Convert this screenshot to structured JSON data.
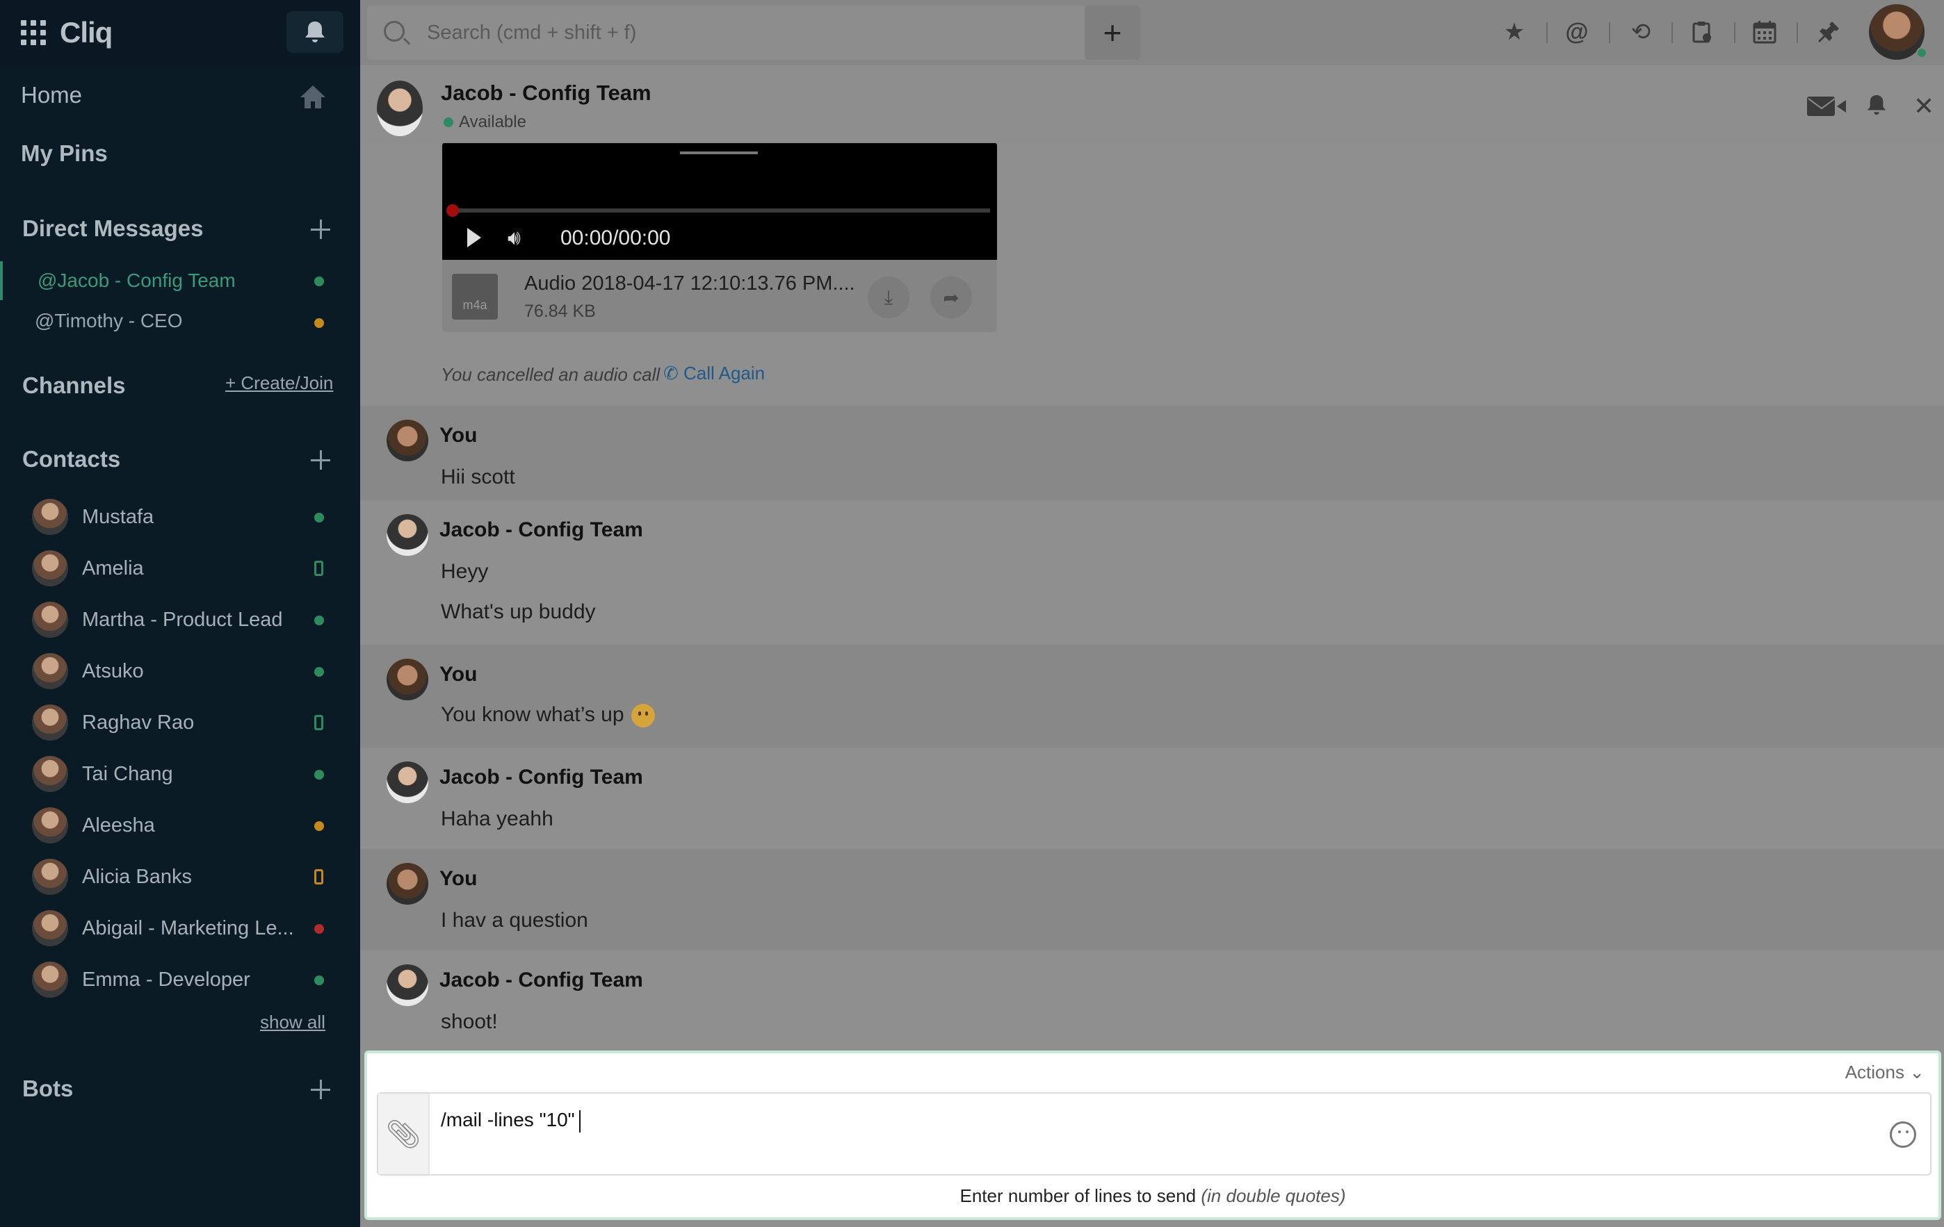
{
  "app": {
    "name": "Cliq"
  },
  "sidebar": {
    "home": "Home",
    "pins": "My Pins",
    "direct_messages": {
      "title": "Direct Messages",
      "items": [
        {
          "label": "@Jacob - Config Team",
          "status": "green",
          "active": true
        },
        {
          "label": "@Timothy - CEO",
          "status": "yellow",
          "active": false
        }
      ]
    },
    "channels": {
      "title": "Channels",
      "create_join": "+ Create/Join"
    },
    "contacts": {
      "title": "Contacts",
      "items": [
        {
          "name": "Mustafa",
          "status": "green-dot"
        },
        {
          "name": "Amelia",
          "status": "green-phone"
        },
        {
          "name": "Martha -  Product Lead",
          "status": "green-dot"
        },
        {
          "name": "Atsuko",
          "status": "green-dot"
        },
        {
          "name": "Raghav Rao",
          "status": "green-phone"
        },
        {
          "name": "Tai Chang",
          "status": "green-dot"
        },
        {
          "name": "Aleesha",
          "status": "yellow-dot"
        },
        {
          "name": "Alicia Banks",
          "status": "yellow-phone"
        },
        {
          "name": "Abigail - Marketing Le...",
          "status": "red-dot"
        },
        {
          "name": "Emma - Developer",
          "status": "green-dot"
        }
      ],
      "show_all": "show all"
    },
    "bots": {
      "title": "Bots"
    }
  },
  "topbar": {
    "search_placeholder": "Search (cmd + shift + f)",
    "icons": [
      "star-icon",
      "mention-icon",
      "history-icon",
      "clipboard-icon",
      "calendar-icon",
      "plugin-icon"
    ]
  },
  "chat_header": {
    "name": "Jacob - Config Team",
    "status": "Available"
  },
  "audio": {
    "time": "00:00/00:00",
    "file_name": "Audio 2018-04-17 12:10:13.76 PM....",
    "file_size": "76.84 KB",
    "file_type": "m4a"
  },
  "call": {
    "text": "You cancelled an audio call",
    "action": "Call Again"
  },
  "messages": [
    {
      "sender": "You",
      "lines": [
        "Hii scott"
      ]
    },
    {
      "sender": "Jacob - Config Team",
      "lines": [
        "Heyy",
        "What's up buddy"
      ]
    },
    {
      "sender": "You",
      "lines": [
        "You know what’s up"
      ]
    },
    {
      "sender": "Jacob - Config Team",
      "lines": [
        "Haha yeahh"
      ]
    },
    {
      "sender": "You",
      "lines": [
        "I hav a question"
      ]
    },
    {
      "sender": "Jacob - Config Team",
      "lines": [
        "shoot!"
      ]
    }
  ],
  "composer": {
    "actions_label": "Actions",
    "text": "/mail -lines \"10\"",
    "hint": "Enter number of lines to send",
    "hint_note": "(in double quotes)"
  },
  "colors": {
    "sidebar_bg": "#0b1b26",
    "accent_green": "#2e8b5e",
    "link_blue": "#1f5a8a"
  }
}
